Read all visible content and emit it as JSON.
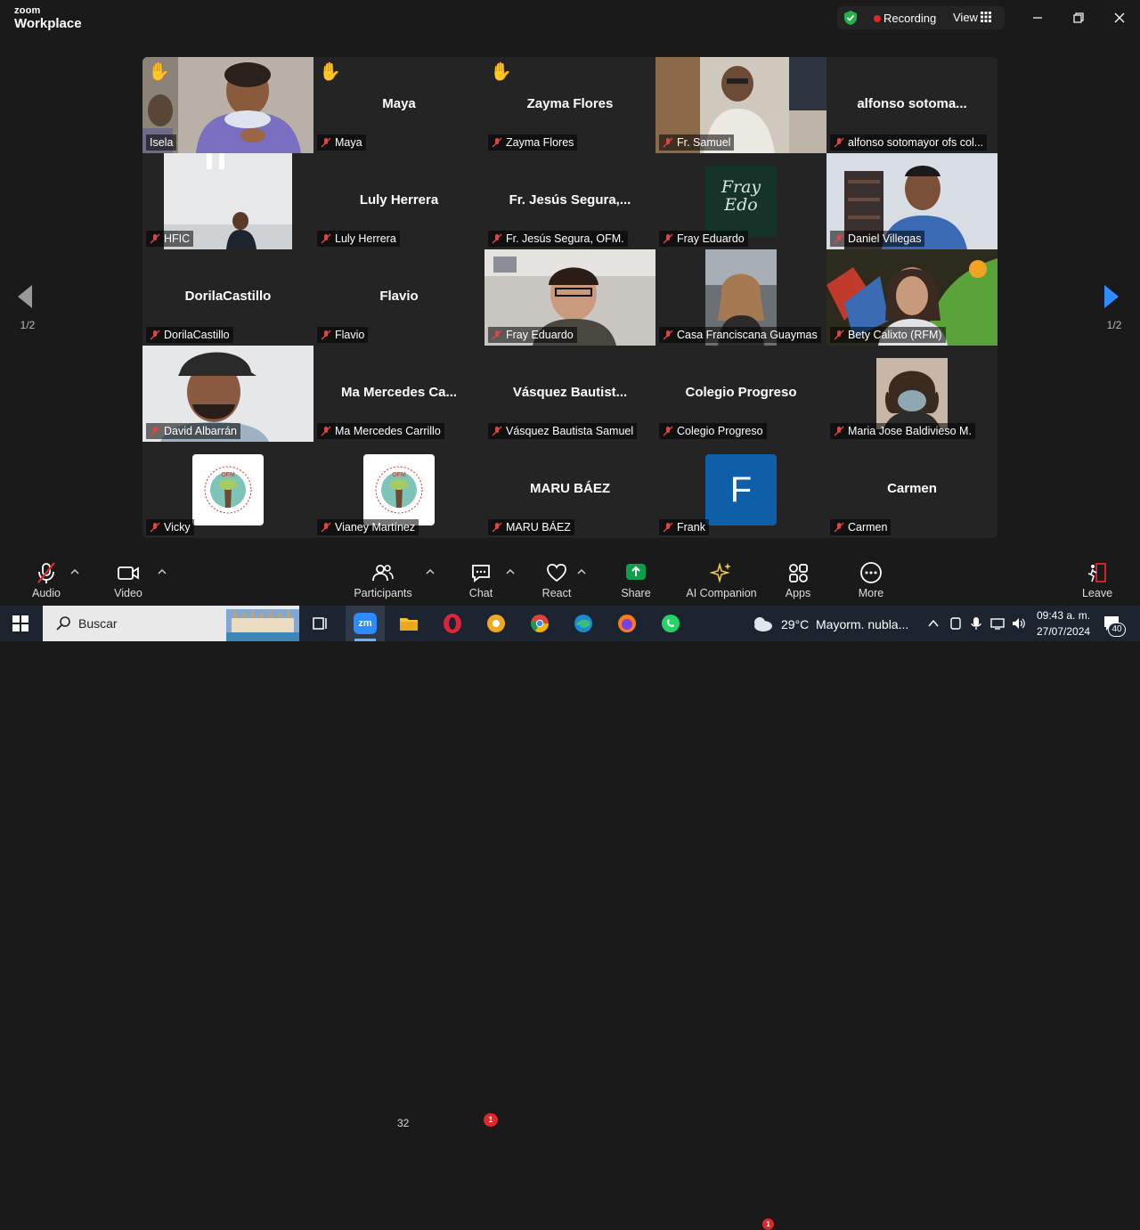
{
  "app": {
    "brand_top": "zoom",
    "brand_bottom": "Workplace",
    "recording_label": "Recording",
    "view_label": "View"
  },
  "colors": {
    "active_speaker": "#2dc26b",
    "recording_dot": "#e02828",
    "raised_hand": "#f8c23a",
    "share_green": "#0e9f4c",
    "nav_arrow": "#2d8cff"
  },
  "tiles": [
    {
      "name": "Isela",
      "center": "",
      "hand": true,
      "video": "person-violet"
    },
    {
      "name": "Maya",
      "center": "Maya",
      "hand": true
    },
    {
      "name": "Zayma Flores",
      "center": "Zayma Flores",
      "hand": true
    },
    {
      "name": "Fr. Samuel",
      "center": "",
      "video": "room-man"
    },
    {
      "name": "alfonso sotomayor ofs col...",
      "center": "alfonso sotoma..."
    },
    {
      "name": "HFIC",
      "center": "",
      "video": "office-small"
    },
    {
      "name": "Luly Herrera",
      "center": "Luly Herrera"
    },
    {
      "name": "Fr. Jesús Segura, OFM.",
      "center": "Fr. Jesús Segura,..."
    },
    {
      "name": "Fray Eduardo",
      "center": "",
      "video": "fray-edo-logo",
      "logo_text": "Fray Edo"
    },
    {
      "name": "Daniel Villegas",
      "center": "",
      "video": "room-blue"
    },
    {
      "name": "DorilaCastillo",
      "center": "DorilaCastillo"
    },
    {
      "name": "Flavio",
      "center": "Flavio"
    },
    {
      "name": "Fray Eduardo",
      "center": "",
      "video": "man-glasses"
    },
    {
      "name": "Casa Franciscana Guaymas",
      "center": "",
      "video": "woman-car"
    },
    {
      "name": "Bety Calixto (RFM)",
      "center": "",
      "video": "mural-woman"
    },
    {
      "name": "David Albarrán",
      "center": "",
      "video": "man-cap"
    },
    {
      "name": "Ma Mercedes Carrillo",
      "center": "Ma Mercedes Ca..."
    },
    {
      "name": "Vásquez Bautista Samuel",
      "center": "Vásquez Bautist..."
    },
    {
      "name": "Colegio Progreso",
      "center": "Colegio Progreso"
    },
    {
      "name": "Maria Jose Baldivieso M.",
      "center": "",
      "video": "woman-mask"
    },
    {
      "name": "Vicky",
      "center": "",
      "video": "jpic-logo",
      "logo_text": "OFM"
    },
    {
      "name": "Vianey Martínez",
      "center": "",
      "video": "jpic-logo",
      "logo_text": "OFM"
    },
    {
      "name": "MARU BÁEZ",
      "center": "MARU BÁEZ"
    },
    {
      "name": "Frank",
      "center": "",
      "video": "avatar-letter",
      "logo_text": "F"
    },
    {
      "name": "Carmen",
      "center": "Carmen"
    }
  ],
  "pager": {
    "left": "1/2",
    "right": "1/2"
  },
  "toolbar": {
    "audio": "Audio",
    "video": "Video",
    "participants": "Participants",
    "participants_count": "32",
    "chat": "Chat",
    "chat_badge": "1",
    "react": "React",
    "share": "Share",
    "ai": "AI Companion",
    "apps": "Apps",
    "more": "More",
    "leave": "Leave"
  },
  "taskbar": {
    "search_placeholder": "Buscar",
    "zoom_label": "zm",
    "weather_badge": "1",
    "weather_temp": "29°C",
    "weather_text": "Mayorm. nubla...",
    "time": "09:43 a. m.",
    "date": "27/07/2024",
    "notif_count": "40"
  }
}
